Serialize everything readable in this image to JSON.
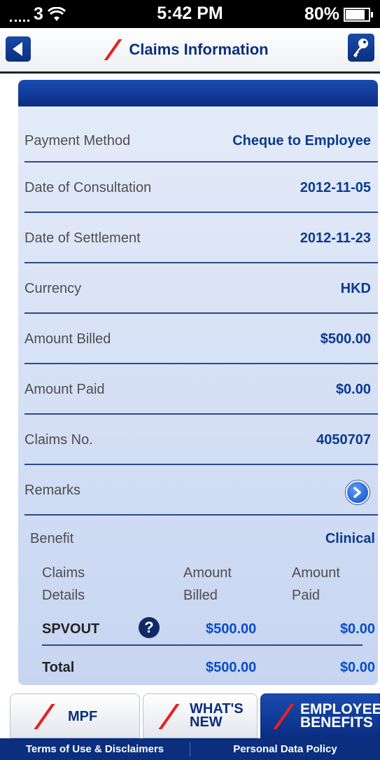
{
  "status_bar": {
    "carrier": "3",
    "time": "5:42 PM",
    "battery": "80%",
    "battery_level": 0.8
  },
  "nav": {
    "title": "Claims Information"
  },
  "details": [
    {
      "label": "Payment Method",
      "value": "Cheque to Employee"
    },
    {
      "label": "Date of Consultation",
      "value": "2012-11-05"
    },
    {
      "label": "Date of Settlement",
      "value": "2012-11-23"
    },
    {
      "label": "Currency",
      "value": "HKD"
    },
    {
      "label": "Amount Billed",
      "value": "$500.00"
    },
    {
      "label": "Amount Paid",
      "value": "$0.00"
    },
    {
      "label": "Claims No.",
      "value": "4050707"
    },
    {
      "label": "Remarks"
    }
  ],
  "benefit": {
    "label": "Benefit",
    "value": "Clinical"
  },
  "claims_table": {
    "headers": [
      {
        "line1": "Claims",
        "line2": "Details"
      },
      {
        "line1": "Amount",
        "line2": "Billed"
      },
      {
        "line1": "Amount",
        "line2": "Paid"
      }
    ],
    "rows": [
      {
        "name": "SPVOUT",
        "billed": "$500.00",
        "paid": "$0.00"
      }
    ],
    "total": {
      "name": "Total",
      "billed": "$500.00",
      "paid": "$0.00"
    }
  },
  "tabs": [
    {
      "line1": "MPF",
      "line2": ""
    },
    {
      "line1": "WHAT'S",
      "line2": "NEW"
    },
    {
      "line1": "EMPLOYEE",
      "line2": "BENEFITS"
    }
  ],
  "footer": {
    "terms": "Terms of Use & Disclaimers",
    "privacy": "Personal Data Policy"
  },
  "colors": {
    "brand_blue": "#0b2f7e",
    "accent_red": "#e52321",
    "value_blue": "#0b4cc7"
  }
}
